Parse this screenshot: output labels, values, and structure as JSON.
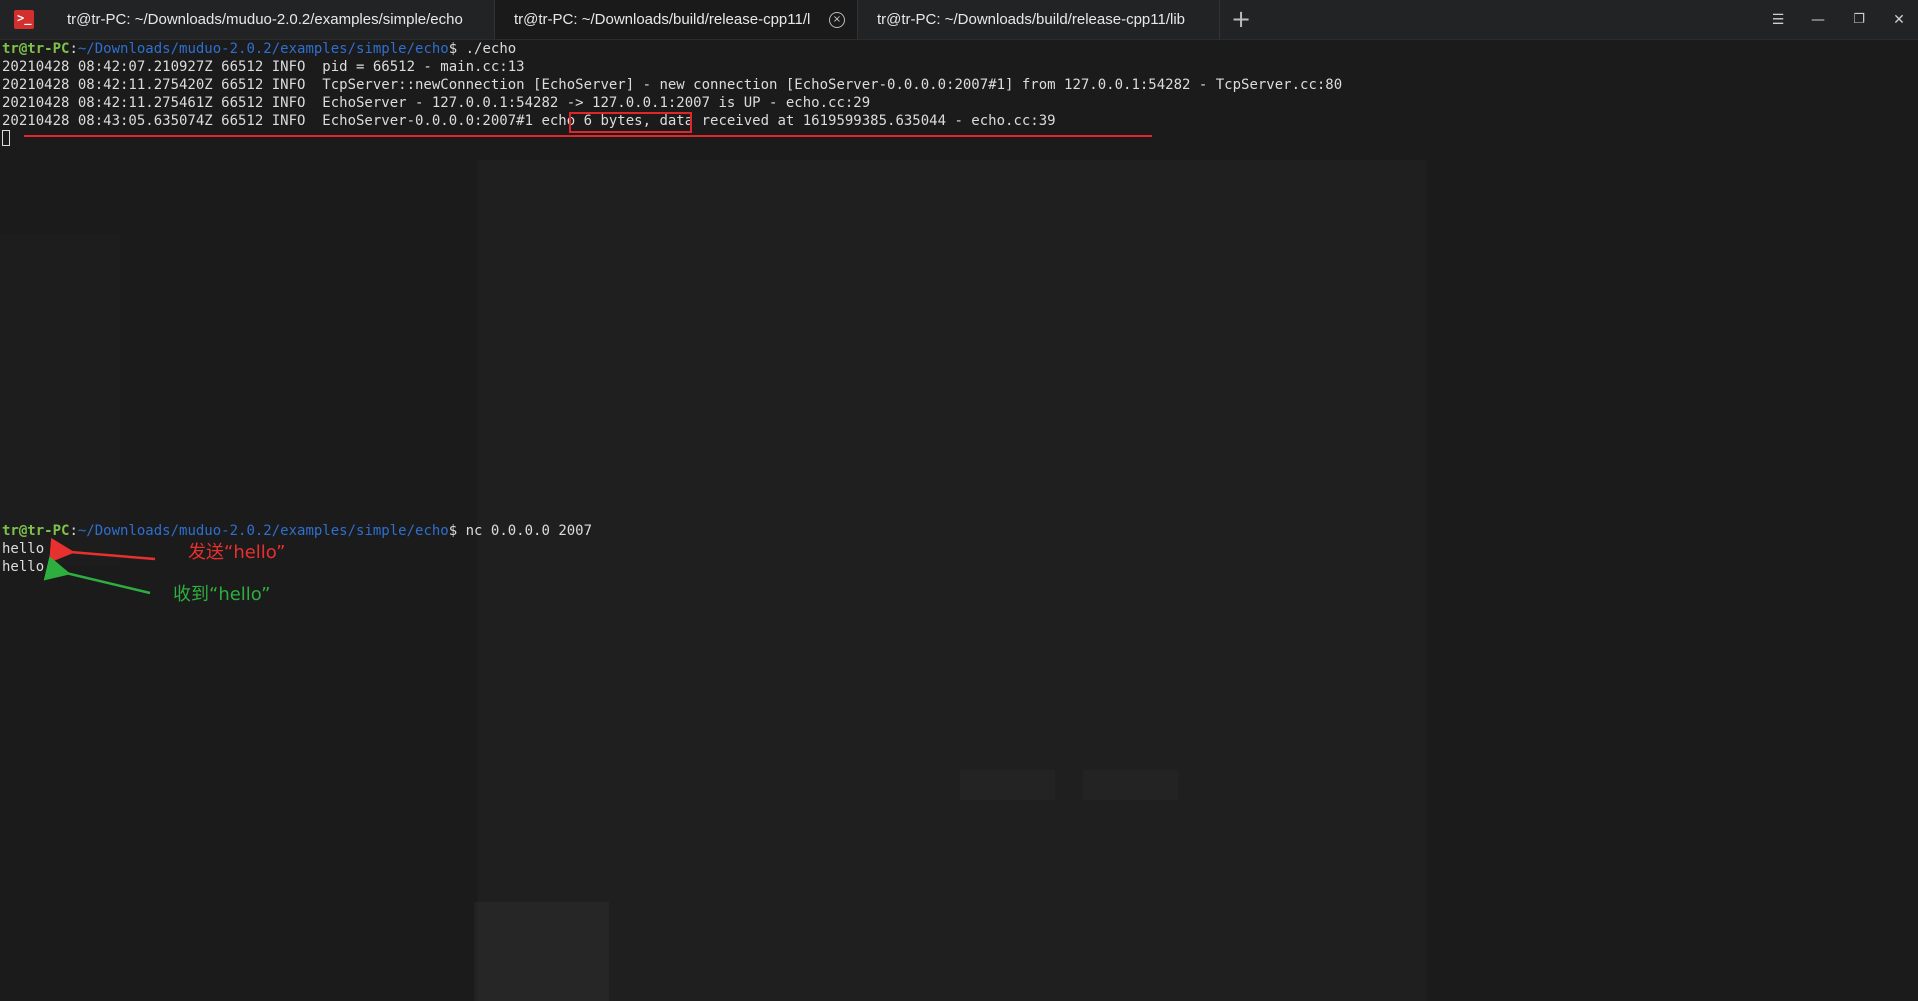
{
  "tabbar": {
    "app_icon_glyph": ">_",
    "tabs": [
      {
        "label": "tr@tr-PC: ~/Downloads/muduo-2.0.2/examples/simple/echo"
      },
      {
        "label": "tr@tr-PC: ~/Downloads/build/release-cpp11/l"
      },
      {
        "label": "tr@tr-PC: ~/Downloads/build/release-cpp11/lib"
      }
    ],
    "close_glyph": "×",
    "add_glyph": "+",
    "window_buttons": {
      "menu": "☰",
      "minimize": "—",
      "maximize": "❐",
      "close": "✕"
    }
  },
  "terminal": {
    "prompt_user": "tr@tr-PC",
    "prompt_sep": ":",
    "prompt_path": "~/Downloads/muduo-2.0.2/examples/simple/echo",
    "command1": "$ ./echo",
    "log_lines": [
      "20210428 08:42:07.210927Z 66512 INFO  pid = 66512 - main.cc:13",
      "20210428 08:42:11.275420Z 66512 INFO  TcpServer::newConnection [EchoServer] - new connection [EchoServer-0.0.0.0:2007#1] from 127.0.0.1:54282 - TcpServer.cc:80",
      "20210428 08:42:11.275461Z 66512 INFO  EchoServer - 127.0.0.1:54282 -> 127.0.0.1:2007 is UP - echo.cc:29",
      "20210428 08:43:05.635074Z 66512 INFO  EchoServer-0.0.0.0:2007#1 echo 6 bytes, data received at 1619599385.635044 - echo.cc:39"
    ],
    "command2": "$ nc 0.0.0.0 2007",
    "output_lines": [
      "hello",
      "hello"
    ]
  },
  "annotations": {
    "sent_label": "发送“hello”",
    "received_label": "收到“hello”",
    "colors": {
      "red": "#e8302f",
      "green": "#2eae3e"
    }
  }
}
